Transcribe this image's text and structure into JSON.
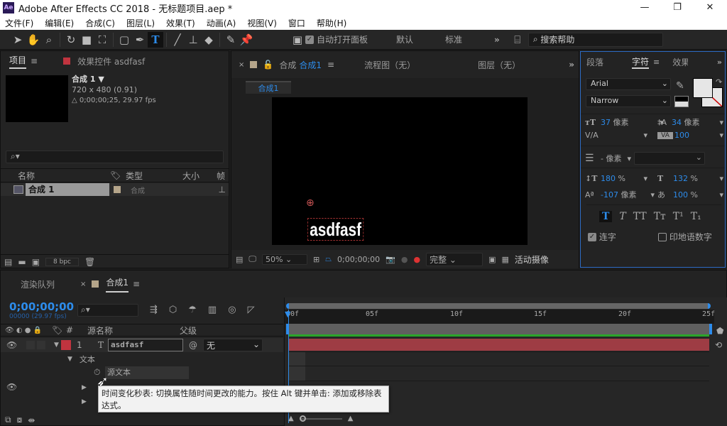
{
  "window": {
    "title": "Adobe After Effects CC 2018 - 无标题项目.aep *",
    "logo": "Ae",
    "minimize": "—",
    "maximize": "❐",
    "close": "✕"
  },
  "menu": [
    "文件(F)",
    "编辑(E)",
    "合成(C)",
    "图层(L)",
    "效果(T)",
    "动画(A)",
    "视图(V)",
    "窗口",
    "帮助(H)"
  ],
  "toolbar": {
    "tools": [
      "selection-icon",
      "hand-icon",
      "zoom-icon",
      "rotate-icon",
      "camera-icon",
      "pan-behind-icon",
      "rectangle-icon",
      "pen-icon",
      "type-icon",
      "brush-icon",
      "clone-stamp-icon",
      "eraser-icon",
      "roto-brush-icon",
      "puppet-pin-icon"
    ],
    "auto_open_label": "自动打开面板",
    "workspace_default": "默认",
    "workspace_standard": "标准",
    "search_help": "搜索帮助"
  },
  "project": {
    "tab_project": "项目",
    "tab_effects": "效果控件 asdfasf",
    "comp_name": "合成 1",
    "comp_size": "720 x 480 (0.91)",
    "comp_duration": "△ 0;00;00;25, 29.97 fps",
    "columns": [
      "名称",
      "类型",
      "大小",
      "帧"
    ],
    "items": [
      {
        "name": "合成 1",
        "type": "合成"
      }
    ],
    "bpc": "8 bpc"
  },
  "viewer": {
    "tab_comp_prefix": "合成",
    "tab_comp_name": "合成1",
    "tab_flow": "流程图（无）",
    "tab_layer": "图层（无）",
    "crumb": "合成1",
    "canvas_text": "asdfasf",
    "zoom": "50%",
    "timecode": "0;00;00;00",
    "resolution": "完整",
    "camera": "活动摄像"
  },
  "character": {
    "tab_paragraph": "段落",
    "tab_character": "字符",
    "tab_effects": "效果",
    "font": "Arial",
    "style": "Narrow",
    "font_size": "37",
    "leading": "34",
    "unit": "像素",
    "kerning": "",
    "tracking": "100",
    "stroke": "-",
    "vscale": "180",
    "hscale": "132",
    "percent": "%",
    "baseline": "-107",
    "tsume": "100",
    "ligatures": "连字",
    "hindi_digits": "印地语数字",
    "fill_color": "#e6e6e6",
    "styles": [
      "T",
      "T",
      "TT",
      "Tт",
      "T¹",
      "T₁"
    ]
  },
  "timeline": {
    "tab_render": "渲染队列",
    "tab_comp": "合成1",
    "timecode": "0;00;00;00",
    "timecode_sub": "00000 (29.97 fps)",
    "col_source": "源名称",
    "col_parent": "父级",
    "ruler": [
      "00f",
      "05f",
      "10f",
      "15f",
      "20f",
      "25f"
    ],
    "layer": {
      "index": "1",
      "name": "asdfasf",
      "parent": "无",
      "color": "#c0343f"
    },
    "props": {
      "text": "文本",
      "source_text": "源文本"
    },
    "tooltip": "时间变化秒表: 切换属性随时间更改的能力。按住 Alt 键并单击: 添加或移除表达式。"
  }
}
